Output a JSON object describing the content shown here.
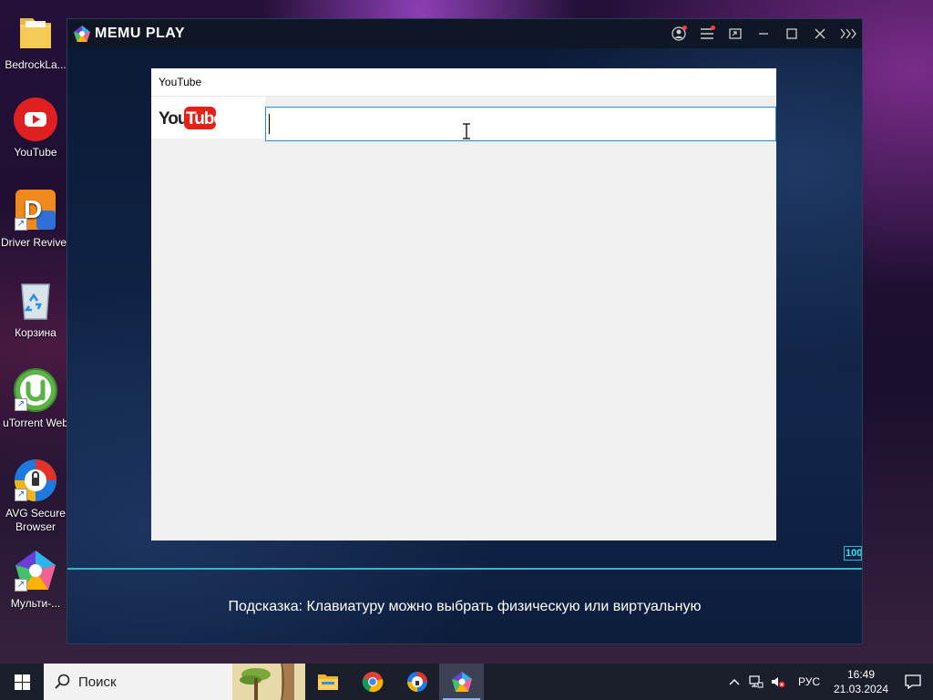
{
  "desktop": {
    "icons": [
      {
        "label": "BedrockLa...",
        "name": "desktop-icon-bedrocklauncher"
      },
      {
        "label": "YouTube",
        "name": "desktop-icon-youtube"
      },
      {
        "label": "Driver Reviver",
        "name": "desktop-icon-driver-reviver"
      },
      {
        "label": "Корзина",
        "name": "desktop-icon-recycle-bin"
      },
      {
        "label": "uTorrent Web",
        "name": "desktop-icon-utorrent-web"
      },
      {
        "label": "AVG Secure Browser",
        "name": "desktop-icon-avg-browser"
      },
      {
        "label": "Мульти-...",
        "name": "desktop-icon-multi-memu"
      }
    ]
  },
  "emulator": {
    "title": "MEMU PLAY",
    "controls": [
      "account-icon",
      "menu-icon",
      "screen-icon",
      "minimize-icon",
      "maximize-icon",
      "close-icon",
      "sidebar-toggle-icon"
    ],
    "progress_badge": "100",
    "hint": "Подсказка: Клавиатуру можно выбрать физическую или виртуальную"
  },
  "youtube_app": {
    "window_title": "YouTube",
    "logo_text_you": "You",
    "logo_text_tube": "Tube",
    "search_value": "",
    "brand_red": "#e62117"
  },
  "taskbar": {
    "search_placeholder": "Поиск",
    "apps": [
      "file-explorer-icon",
      "chrome-icon",
      "avg-browser-icon",
      "memu-icon"
    ],
    "active_app": "memu-icon",
    "language": "РУС",
    "time": "16:49",
    "date": "21.03.2024"
  }
}
